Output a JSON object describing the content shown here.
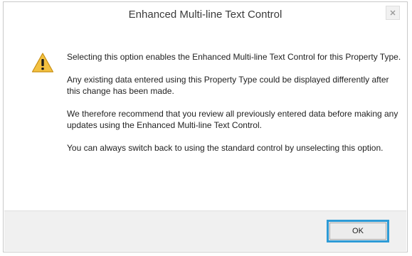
{
  "dialog": {
    "title": "Enhanced Multi-line Text Control",
    "icon": "warning-icon",
    "messages": [
      "Selecting this option enables the Enhanced Multi-line Text Control for this Property Type.",
      "Any existing data entered using this Property Type could be displayed differently after this change has been made.",
      "We therefore recommend that you review all previously entered data before making any updates using the Enhanced Multi-line Text Control.",
      "You can always switch back to using the standard control by unselecting this option."
    ],
    "ok_label": "OK"
  },
  "colors": {
    "accent_border": "#2d9bd6",
    "warning_fill": "#f3c140"
  }
}
